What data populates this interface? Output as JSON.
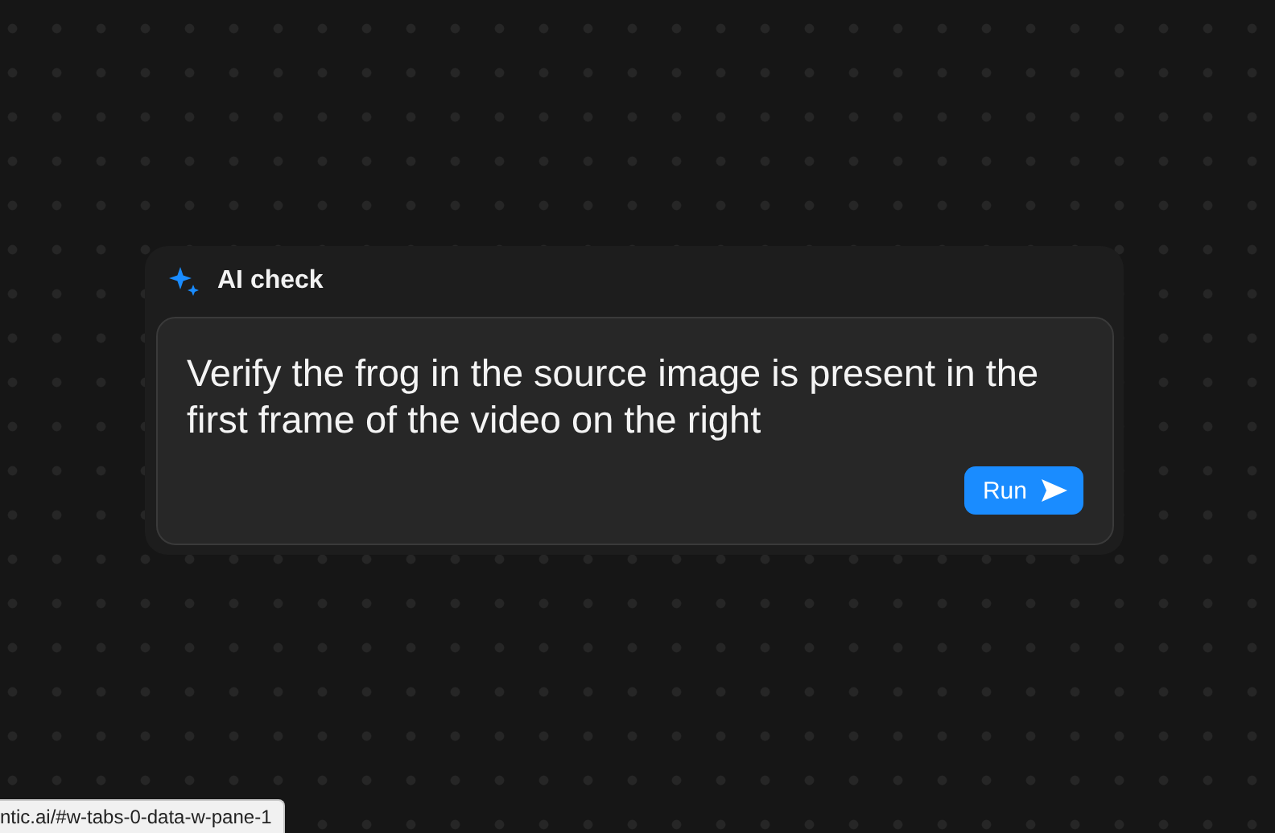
{
  "panel": {
    "title": "AI check",
    "prompt": "Verify the frog in the source image is present in the first frame of the video on the right",
    "button": "Run"
  },
  "status_bar": {
    "url": "ntic.ai/#w-tabs-0-data-w-pane-1"
  }
}
